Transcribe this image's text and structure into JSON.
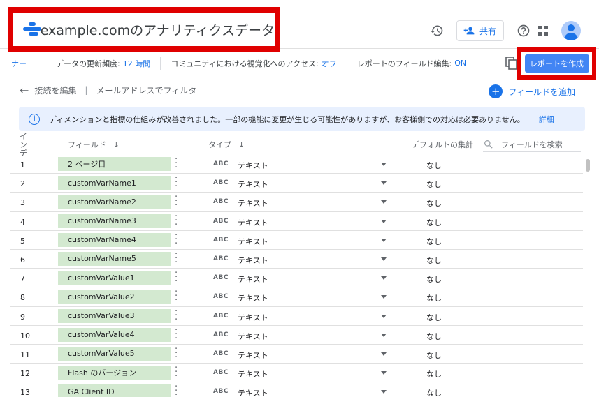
{
  "header": {
    "title": "example.comのアナリティクスデータ",
    "share_label": "共有"
  },
  "settings": {
    "partial_label": "ナー",
    "refresh_label": "データの更新頻度:",
    "refresh_value": "12 時間",
    "community_label": "コミュニティにおける視覚化へのアクセス:",
    "community_value": "オフ",
    "field_edit_label": "レポートのフィールド編集:",
    "field_edit_value": "ON",
    "create_report": "レポートを作成"
  },
  "subbar": {
    "edit_connection": "接続を編集",
    "filter_by_email": "メールアドレスでフィルタ",
    "add_field": "フィールドを追加"
  },
  "info": {
    "message": "ディメンションと指標の仕組みが改善されました。一部の機能に変更が生じる可能性がありますが、お客様側での対応は必要ありません。",
    "detail_link": "詳細"
  },
  "table": {
    "index_header": "インデックス",
    "field_header": "フィールド",
    "type_header": "タイプ",
    "agg_header": "デフォルトの集計",
    "search_placeholder": "フィールドを検索",
    "rows": [
      {
        "num": "1",
        "field": "2 ページ目",
        "type_icon": "ABC",
        "type": "テキスト",
        "agg": "なし"
      },
      {
        "num": "2",
        "field": "customVarName1",
        "type_icon": "ABC",
        "type": "テキスト",
        "agg": "なし"
      },
      {
        "num": "3",
        "field": "customVarName2",
        "type_icon": "ABC",
        "type": "テキスト",
        "agg": "なし"
      },
      {
        "num": "4",
        "field": "customVarName3",
        "type_icon": "ABC",
        "type": "テキスト",
        "agg": "なし"
      },
      {
        "num": "5",
        "field": "customVarName4",
        "type_icon": "ABC",
        "type": "テキスト",
        "agg": "なし"
      },
      {
        "num": "6",
        "field": "customVarName5",
        "type_icon": "ABC",
        "type": "テキスト",
        "agg": "なし"
      },
      {
        "num": "7",
        "field": "customVarValue1",
        "type_icon": "ABC",
        "type": "テキスト",
        "agg": "なし"
      },
      {
        "num": "8",
        "field": "customVarValue2",
        "type_icon": "ABC",
        "type": "テキスト",
        "agg": "なし"
      },
      {
        "num": "9",
        "field": "customVarValue3",
        "type_icon": "ABC",
        "type": "テキスト",
        "agg": "なし"
      },
      {
        "num": "10",
        "field": "customVarValue4",
        "type_icon": "ABC",
        "type": "テキスト",
        "agg": "なし"
      },
      {
        "num": "11",
        "field": "customVarValue5",
        "type_icon": "ABC",
        "type": "テキスト",
        "agg": "なし"
      },
      {
        "num": "12",
        "field": "Flash のバージョン",
        "type_icon": "ABC",
        "type": "テキスト",
        "agg": "なし"
      },
      {
        "num": "13",
        "field": "GA Client ID",
        "type_icon": "ABC",
        "type": "テキスト",
        "agg": "なし"
      }
    ]
  },
  "colors": {
    "accent": "#1a73e8",
    "highlight_border": "#e00000",
    "chip_bg": "#d3e9d0",
    "info_bg": "#e8f0fe",
    "create_button": "#4285f4"
  }
}
